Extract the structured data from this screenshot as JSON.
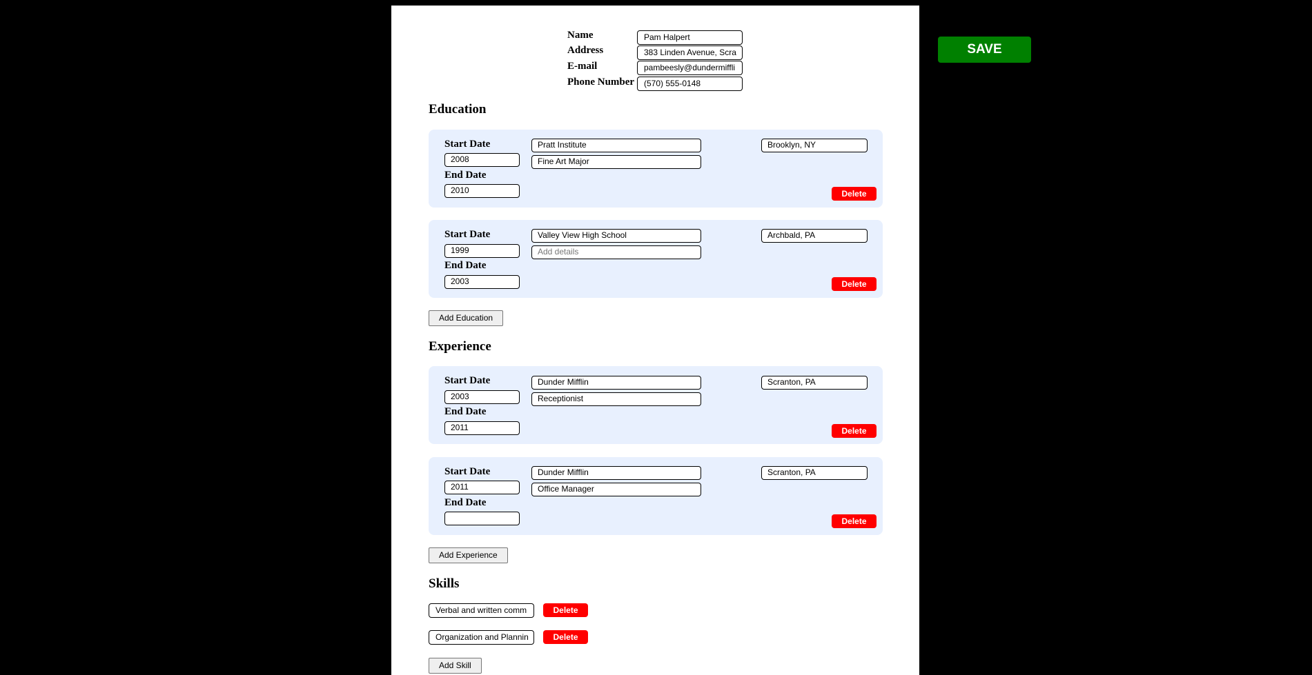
{
  "contact": {
    "name_label": "Name",
    "name_value": "Pam Halpert",
    "address_label": "Address",
    "address_value": "383 Linden Avenue, Scra",
    "email_label": "E-mail",
    "email_value": "pambeesly@dundermiffli",
    "phone_label": "Phone Number",
    "phone_value": "(570) 555-0148"
  },
  "save_label": "SAVE",
  "education": {
    "title": "Education",
    "start_label": "Start Date",
    "end_label": "End Date",
    "delete_label": "Delete",
    "add_label": "Add Education",
    "details_placeholder": "Add details",
    "items": [
      {
        "start": "2008",
        "end": "2010",
        "school": "Pratt Institute",
        "details": "Fine Art Major",
        "location": "Brooklyn, NY"
      },
      {
        "start": "1999",
        "end": "2003",
        "school": "Valley View High School",
        "details": "",
        "location": "Archbald, PA"
      }
    ]
  },
  "experience": {
    "title": "Experience",
    "start_label": "Start Date",
    "end_label": "End Date",
    "delete_label": "Delete",
    "add_label": "Add Experience",
    "items": [
      {
        "start": "2003",
        "end": "2011",
        "company": "Dunder Mifflin",
        "role": "Receptionist",
        "location": "Scranton, PA"
      },
      {
        "start": "2011",
        "end": "",
        "company": "Dunder Mifflin",
        "role": "Office Manager",
        "location": "Scranton, PA"
      }
    ]
  },
  "skills": {
    "title": "Skills",
    "delete_label": "Delete",
    "add_label": "Add Skill",
    "items": [
      "Verbal and written comm",
      "Organization and Plannin"
    ]
  }
}
